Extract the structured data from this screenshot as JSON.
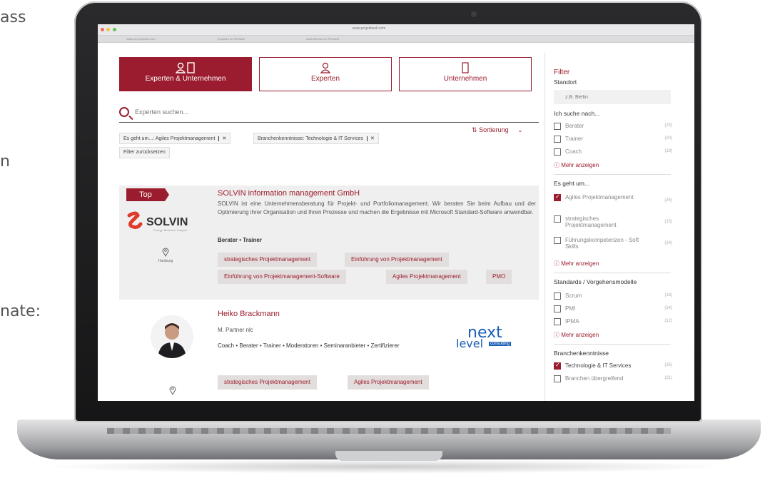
{
  "background_fragments": [
    "ass",
    "n",
    "nate:"
  ],
  "browser": {
    "url": "www.projektwelt.com",
    "tabs": [
      "www.pm-experten.com",
      "Experten im PM-Netz",
      "Unternehmen im PM-Netz"
    ]
  },
  "categories": [
    {
      "label": "Experten & Unternehmen",
      "icon": "person-building-icon",
      "active": true
    },
    {
      "label": "Experten",
      "icon": "person-icon",
      "active": false
    },
    {
      "label": "Unternehmen",
      "icon": "building-icon",
      "active": false
    }
  ],
  "search": {
    "placeholder": "Experten suchen..."
  },
  "active_filters": [
    {
      "label": "Es geht um...: Agiles Projektmanagement"
    },
    {
      "label": "Branchenkenntnisse: Technologie & IT Services"
    }
  ],
  "reset_filters_label": "Filter zurücksetzen",
  "sort_label": "Sortierung",
  "results": [
    {
      "badge": "Top",
      "title": "SOLVIN information management GmbH",
      "description": "SOLVIN ist eine Unternehmensberatung für Projekt- und Portfoliomanagement. Wir beraten Sie beim Aufbau und der Optimierung ihrer Organisation und Ihren Prozesse und machen die Ergebnisse mit Microsoft Standard-Software anwendbar.",
      "roles": "Berater • Trainer",
      "logo_text": "SOLVIN",
      "logo_sub": "Energy. Business. Insights",
      "location": "Hamburg",
      "tags": [
        "strategisches Projektmanagement",
        "Einführung von Projektmanagement",
        "Einführung von Projektmanagement-Software",
        "Agiles Projektmanagement",
        "PMO"
      ]
    },
    {
      "title": "Heiko Brackmann",
      "subtitle": "M. Partner nlc",
      "roles": "Coach • Berater • Trainer • Moderatoren • Seminaranbieter • Zertifizierer",
      "company_logo_a": "next",
      "company_logo_b": "level",
      "company_logo_c": "consulting",
      "tags": [
        "strategisches Projektmanagement",
        "Agiles Projektmanagement"
      ]
    }
  ],
  "sidebar": {
    "title": "Filter",
    "location_heading": "Standort",
    "location_placeholder": "z.B. Berlin",
    "search_heading": "Ich suche nach...",
    "search_options": [
      {
        "label": "Berater",
        "count": "(23)",
        "checked": false
      },
      {
        "label": "Trainer",
        "count": "(20)",
        "checked": false
      },
      {
        "label": "Coach",
        "count": "(19)",
        "checked": false
      }
    ],
    "more_label": "Mehr anzeigen",
    "topic_heading": "Es geht um...",
    "topic_options": [
      {
        "label": "Agiles Projektmanagement",
        "count": "(25)",
        "checked": true
      },
      {
        "label": "strategisches Projektmanagement",
        "count": "(15)",
        "checked": false
      },
      {
        "label": "Führungskompetenzen - Soft Skills",
        "count": "(14)",
        "checked": false
      }
    ],
    "standards_heading": "Standards / Vorgehensmodelle",
    "standards_options": [
      {
        "label": "Scrum",
        "count": "(18)",
        "checked": false
      },
      {
        "label": "PMI",
        "count": "(14)",
        "checked": false
      },
      {
        "label": "IPMA",
        "count": "(12)",
        "checked": false
      }
    ],
    "industry_heading": "Branchenkenntnisse",
    "industry_options": [
      {
        "label": "Technologie & IT Services",
        "count": "(25)",
        "checked": true
      },
      {
        "label": "Branchen übergreifend",
        "count": "(21)",
        "checked": false
      }
    ]
  },
  "colors": {
    "accent": "#9b1c2e",
    "tag_bg": "#e2dedd",
    "card_bg": "#efefef"
  }
}
